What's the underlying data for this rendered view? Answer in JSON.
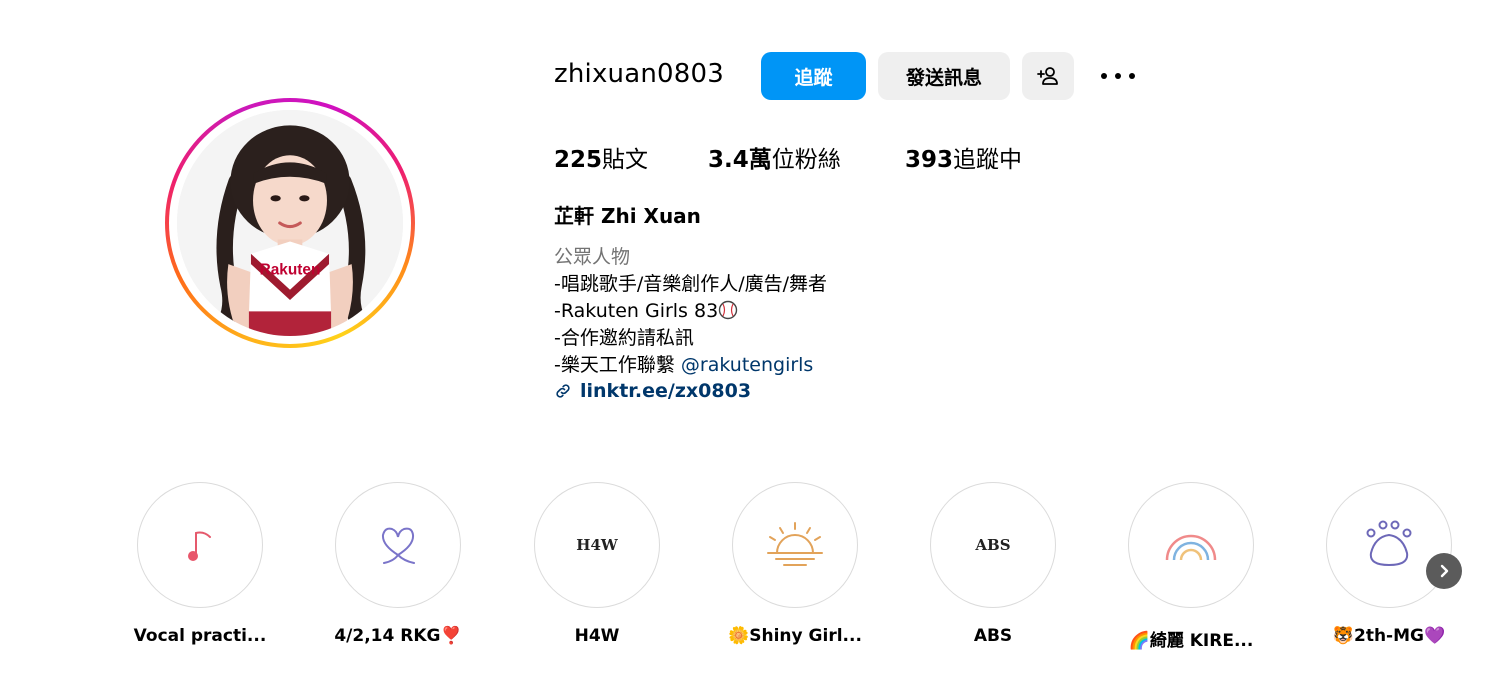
{
  "profile": {
    "username": "zhixuan0803",
    "follow_label": "追蹤",
    "message_label": "發送訊息",
    "add_user_icon": "person-add-icon",
    "more_icon": "more-dots-icon"
  },
  "stats": {
    "posts_value": "225",
    "posts_label": "貼文",
    "followers_value": "3.4萬",
    "followers_label": "位粉絲",
    "following_value": "393",
    "following_label": "追蹤中"
  },
  "bio": {
    "full_name": "芷軒 Zhi Xuan",
    "category": "公眾人物",
    "line1": "-唱跳歌手/音樂創作人/廣告/舞者",
    "line2": "-Rakuten Girls 83",
    "line3": "-合作邀約請私訊",
    "line4_prefix": "-樂天工作聯繫 ",
    "line4_mention": "@rakutengirls",
    "link": "linktr.ee/zx0803"
  },
  "avatar": {
    "shirt_text": "Rakuten"
  },
  "highlights": [
    {
      "label": "Vocal practi...",
      "icon": "music-note-icon"
    },
    {
      "label": "4/2,14 RKG❣️",
      "icon": "heart-icon"
    },
    {
      "label": "H4W",
      "icon_text": "H4W"
    },
    {
      "label": "🌼Shiny Girl...",
      "icon": "sunrise-icon"
    },
    {
      "label": "ABS",
      "icon_text": "ABS"
    },
    {
      "label": "🌈綺麗 KIRE...",
      "icon": "rainbow-icon"
    },
    {
      "label": "🐯2th-MG💜",
      "icon": "paw-icon"
    }
  ],
  "colors": {
    "follow_button": "#0095f6",
    "secondary_button": "#efefef",
    "link": "#00376b",
    "muted": "#737373"
  }
}
